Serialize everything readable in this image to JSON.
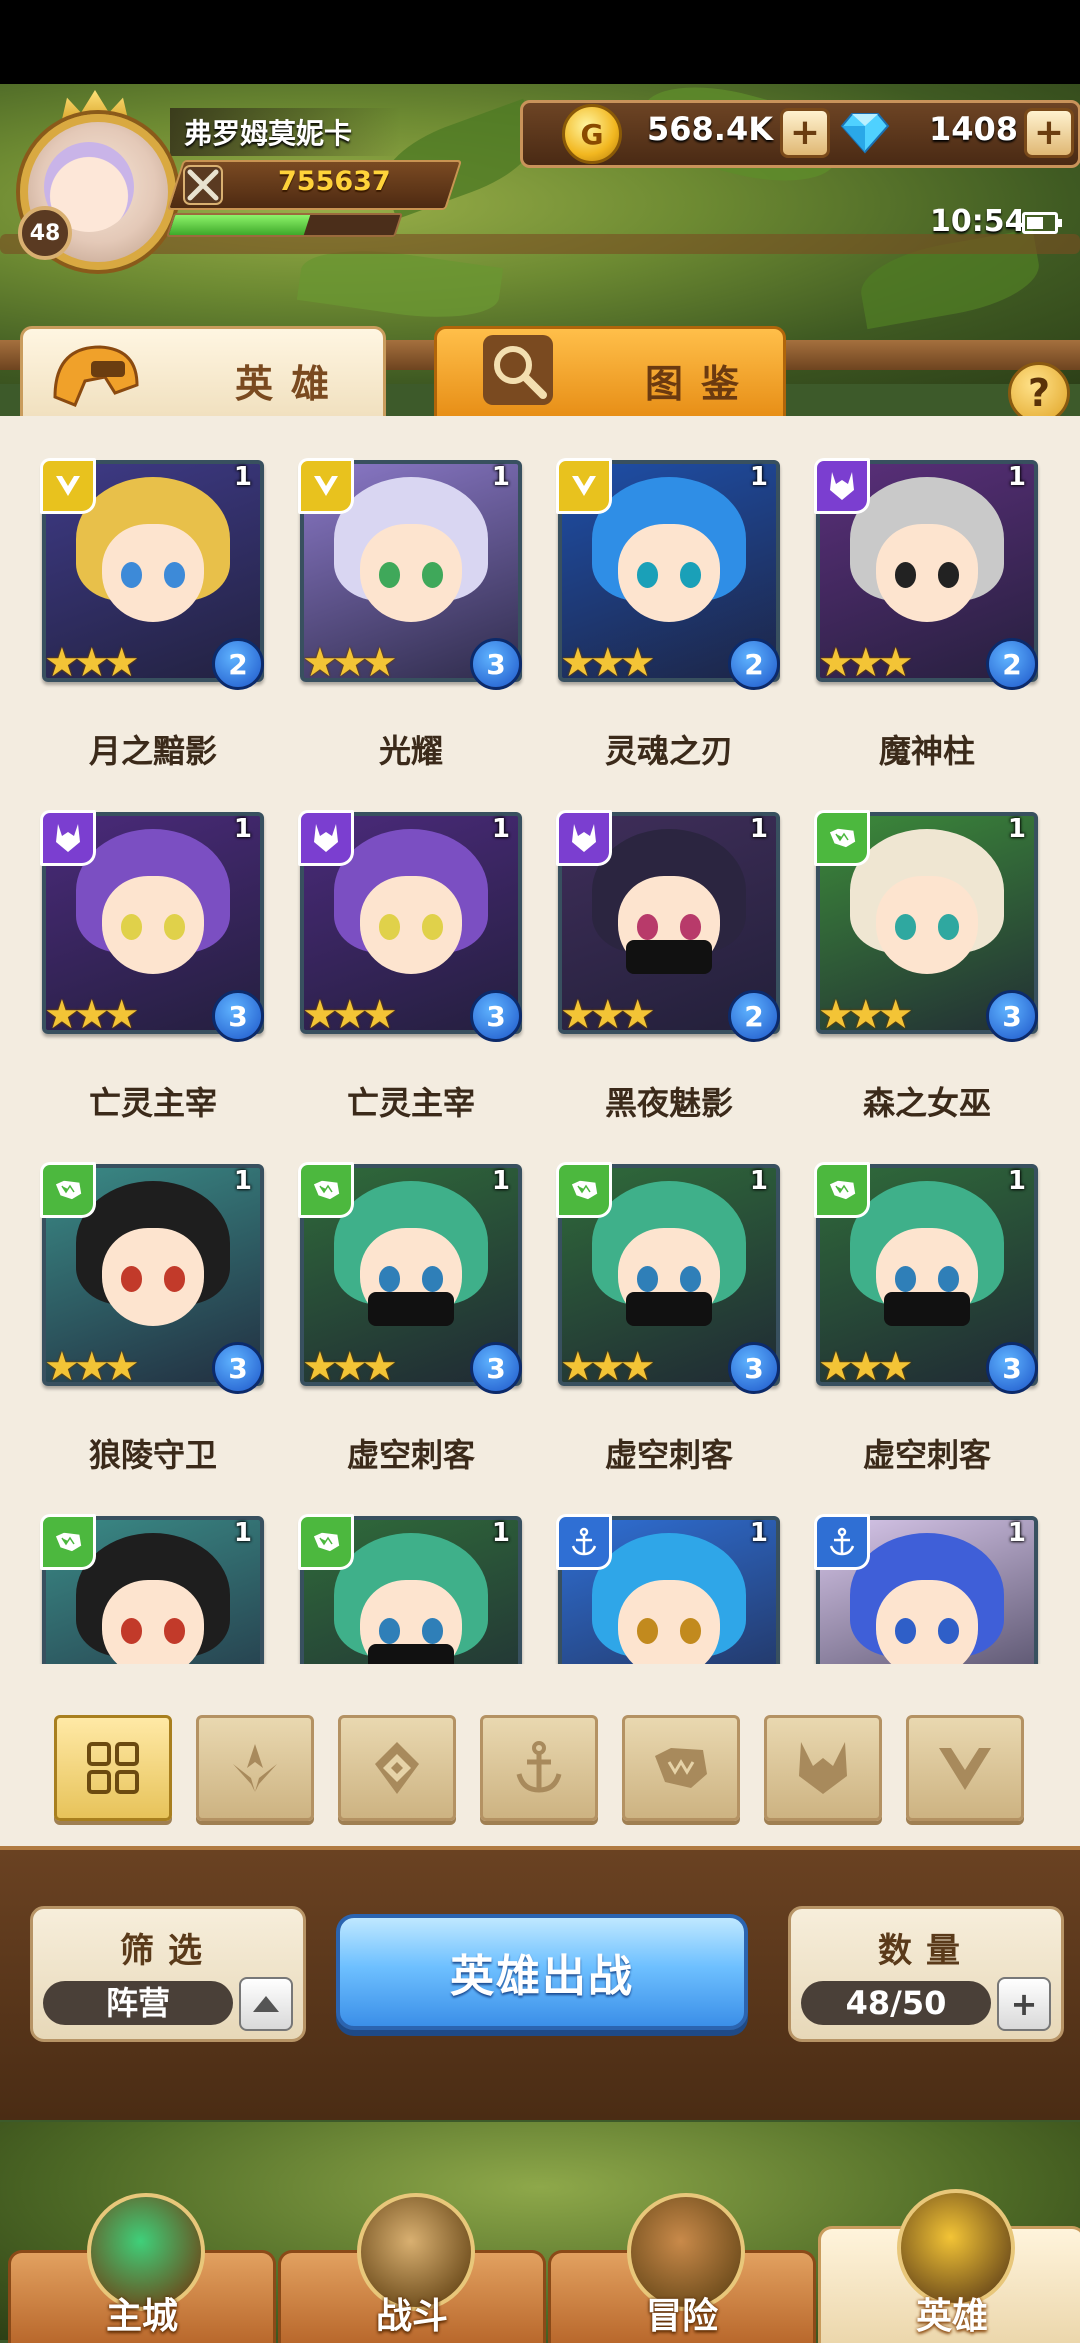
{
  "player": {
    "name": "弗罗姆莫妮卡",
    "level": "48",
    "power": "755637",
    "exp_fraction": 0.6
  },
  "currency": {
    "gold": "568.4K",
    "gold_glyph": "G",
    "gems": "1408"
  },
  "status": {
    "time": "10:54"
  },
  "tabs": [
    {
      "label": "英雄",
      "active": true
    },
    {
      "label": "图鉴",
      "active": false
    }
  ],
  "help": "?",
  "heroes": [
    {
      "name": "月之黯影",
      "faction": "light",
      "level": "1",
      "stars": "★★★",
      "rank": "2",
      "hair": "#e8c04a",
      "bg": "#3e3a86",
      "eye": "#3d8ad8",
      "mask": false
    },
    {
      "name": "光耀",
      "faction": "light",
      "level": "1",
      "stars": "★★★",
      "rank": "3",
      "hair": "#d9d6f2",
      "bg": "#8b79c8",
      "eye": "#3fa85a",
      "mask": false
    },
    {
      "name": "灵魂之刃",
      "faction": "light",
      "level": "1",
      "stars": "★★★",
      "rank": "2",
      "hair": "#2f8ee6",
      "bg": "#1e4fa8",
      "eye": "#1aa0b8",
      "mask": false
    },
    {
      "name": "魔神柱",
      "faction": "dark",
      "level": "1",
      "stars": "★★★",
      "rank": "2",
      "hair": "#c9c9c9",
      "bg": "#5a2f7a",
      "eye": "#222222",
      "mask": false
    },
    {
      "name": "亡灵主宰",
      "faction": "dark",
      "level": "1",
      "stars": "★★★",
      "rank": "3",
      "hair": "#7b4fc2",
      "bg": "#4a2a7a",
      "eye": "#e0d14a",
      "mask": false
    },
    {
      "name": "亡灵主宰",
      "faction": "dark",
      "level": "1",
      "stars": "★★★",
      "rank": "3",
      "hair": "#7b4fc2",
      "bg": "#4a2a7a",
      "eye": "#e0d14a",
      "mask": false
    },
    {
      "name": "黑夜魅影",
      "faction": "dark",
      "level": "1",
      "stars": "★★★",
      "rank": "2",
      "hair": "#2b2540",
      "bg": "#3f2e5a",
      "eye": "#b83a6a",
      "mask": true
    },
    {
      "name": "森之女巫",
      "faction": "forest",
      "level": "1",
      "stars": "★★★",
      "rank": "3",
      "hair": "#efe6d2",
      "bg": "#3c8a3a",
      "eye": "#2fa8a0",
      "mask": false
    },
    {
      "name": "狼陵守卫",
      "faction": "forest",
      "level": "1",
      "stars": "★★★",
      "rank": "3",
      "hair": "#1e1e1e",
      "bg": "#3a8a86",
      "eye": "#c23a2a",
      "mask": false
    },
    {
      "name": "虚空刺客",
      "faction": "forest",
      "level": "1",
      "stars": "★★★",
      "rank": "3",
      "hair": "#3fb08a",
      "bg": "#2f6a3a",
      "eye": "#2f7fb8",
      "mask": true
    },
    {
      "name": "虚空刺客",
      "faction": "forest",
      "level": "1",
      "stars": "★★★",
      "rank": "3",
      "hair": "#3fb08a",
      "bg": "#2f6a3a",
      "eye": "#2f7fb8",
      "mask": true
    },
    {
      "name": "虚空刺客",
      "faction": "forest",
      "level": "1",
      "stars": "★★★",
      "rank": "3",
      "hair": "#3fb08a",
      "bg": "#2f6a3a",
      "eye": "#2f7fb8",
      "mask": true
    },
    {
      "name": "",
      "faction": "forest",
      "level": "1",
      "stars": "",
      "rank": "",
      "hair": "#1e1e1e",
      "bg": "#3a8a86",
      "eye": "#c23a2a",
      "mask": false
    },
    {
      "name": "",
      "faction": "forest",
      "level": "1",
      "stars": "",
      "rank": "",
      "hair": "#3fb08a",
      "bg": "#2f6a3a",
      "eye": "#2f7fb8",
      "mask": true
    },
    {
      "name": "",
      "faction": "sea",
      "level": "1",
      "stars": "",
      "rank": "",
      "hair": "#2fa6e8",
      "bg": "#2f6fd4",
      "eye": "#c28a1e",
      "mask": false
    },
    {
      "name": "",
      "faction": "sea",
      "level": "1",
      "stars": "",
      "rank": "",
      "hair": "#3f5fd8",
      "bg": "#d8c7ea",
      "eye": "#2f5fc8",
      "mask": false
    }
  ],
  "faction_filters": [
    {
      "icon": "all-grid-icon",
      "active": true
    },
    {
      "icon": "light-faction-icon",
      "active": false
    },
    {
      "icon": "rune-faction-icon",
      "active": false
    },
    {
      "icon": "anchor-faction-icon",
      "active": false
    },
    {
      "icon": "beast-faction-icon",
      "active": false
    },
    {
      "icon": "demon-faction-icon",
      "active": false
    },
    {
      "icon": "wing-faction-icon",
      "active": false
    }
  ],
  "filter_panel": {
    "title": "筛选",
    "value": "阵营"
  },
  "deploy_button": "英雄出战",
  "count_panel": {
    "title": "数量",
    "value": "48/50"
  },
  "bottom_nav": [
    {
      "label": "主城",
      "active": false
    },
    {
      "label": "战斗",
      "active": false
    },
    {
      "label": "冒险",
      "active": false
    },
    {
      "label": "英雄",
      "active": true
    }
  ],
  "colors": {
    "wood": "#6a4222",
    "paper": "#f3ece0",
    "accent_gold": "#f3c436",
    "deploy_blue": "#3b8fe8"
  }
}
